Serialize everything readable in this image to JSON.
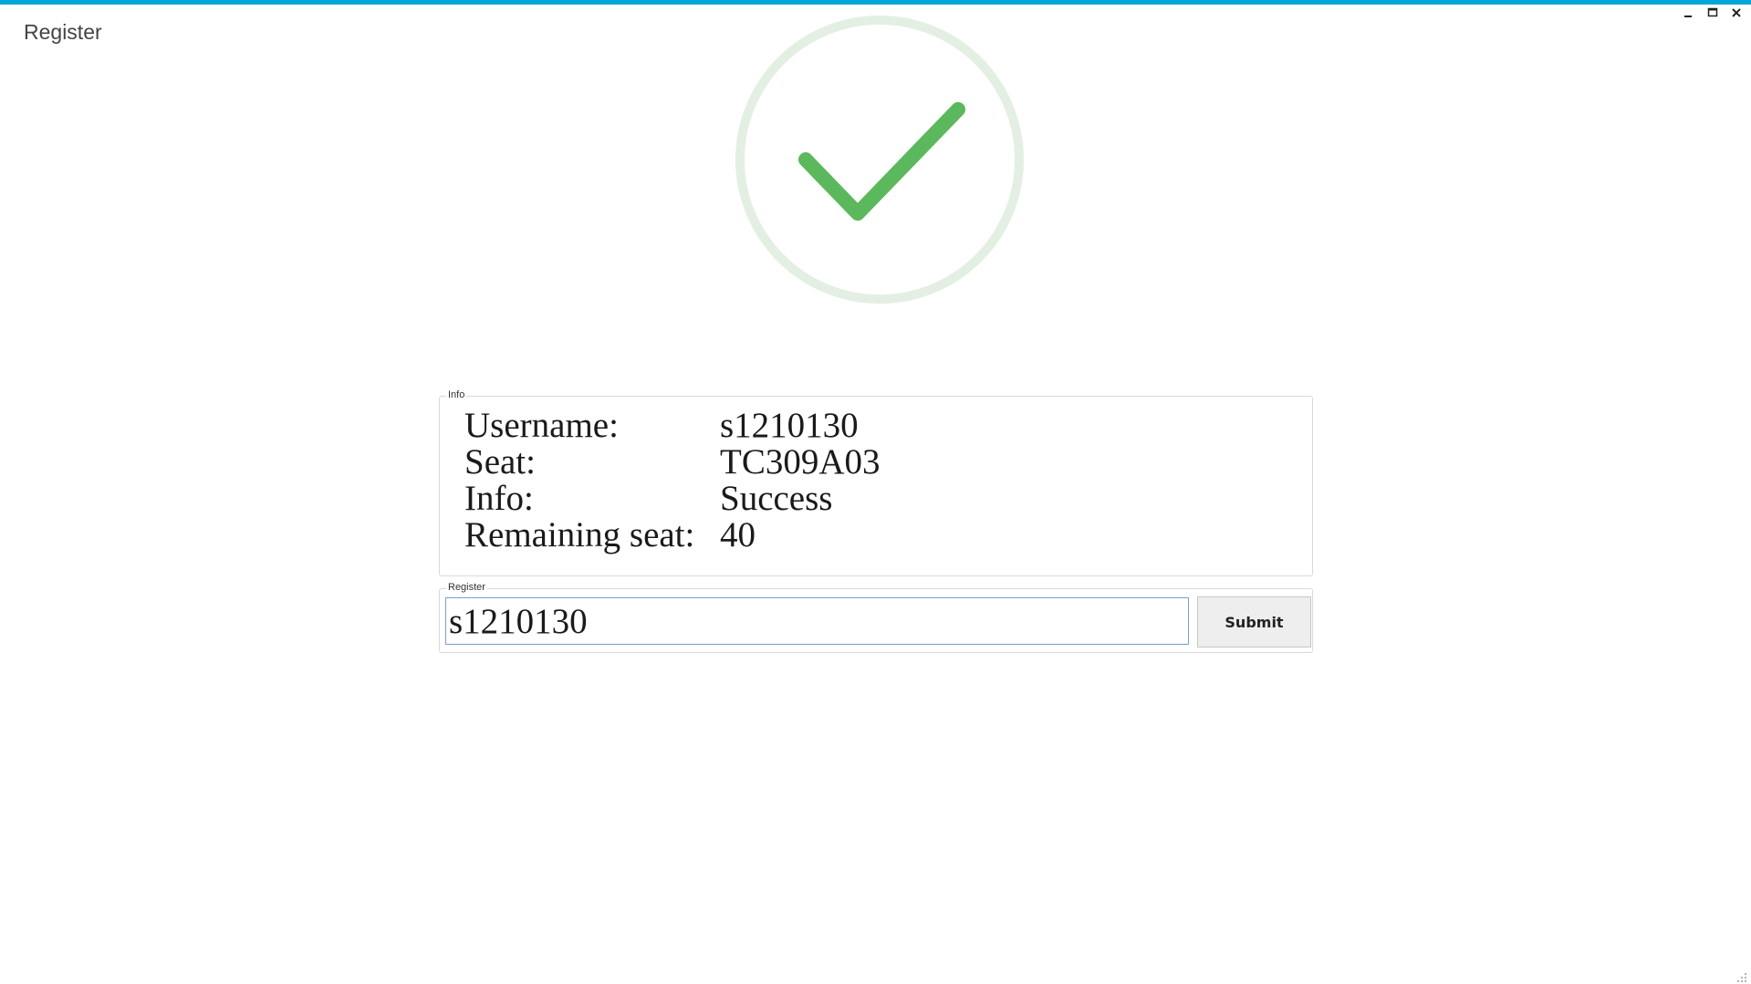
{
  "window": {
    "title": "Register",
    "controls": {
      "minimize_icon": "minimize-icon",
      "maximize_icon": "maximize-icon",
      "close_icon": "close-icon"
    },
    "accent_color": "#00a8d8"
  },
  "status": {
    "icon": "checkmark-icon",
    "state": "success",
    "check_color": "#5cb85c",
    "ring_color": "#e3efe3"
  },
  "info_box": {
    "legend": "Info",
    "rows": [
      {
        "label": "Username:",
        "value": "s1210130"
      },
      {
        "label": "Seat:",
        "value": "TC309A03"
      },
      {
        "label": "Info:",
        "value": "Success"
      },
      {
        "label": "Remaining seat:",
        "value": "40"
      }
    ]
  },
  "register_box": {
    "legend": "Register",
    "input_value": "s1210130",
    "submit_label": "Submit"
  }
}
